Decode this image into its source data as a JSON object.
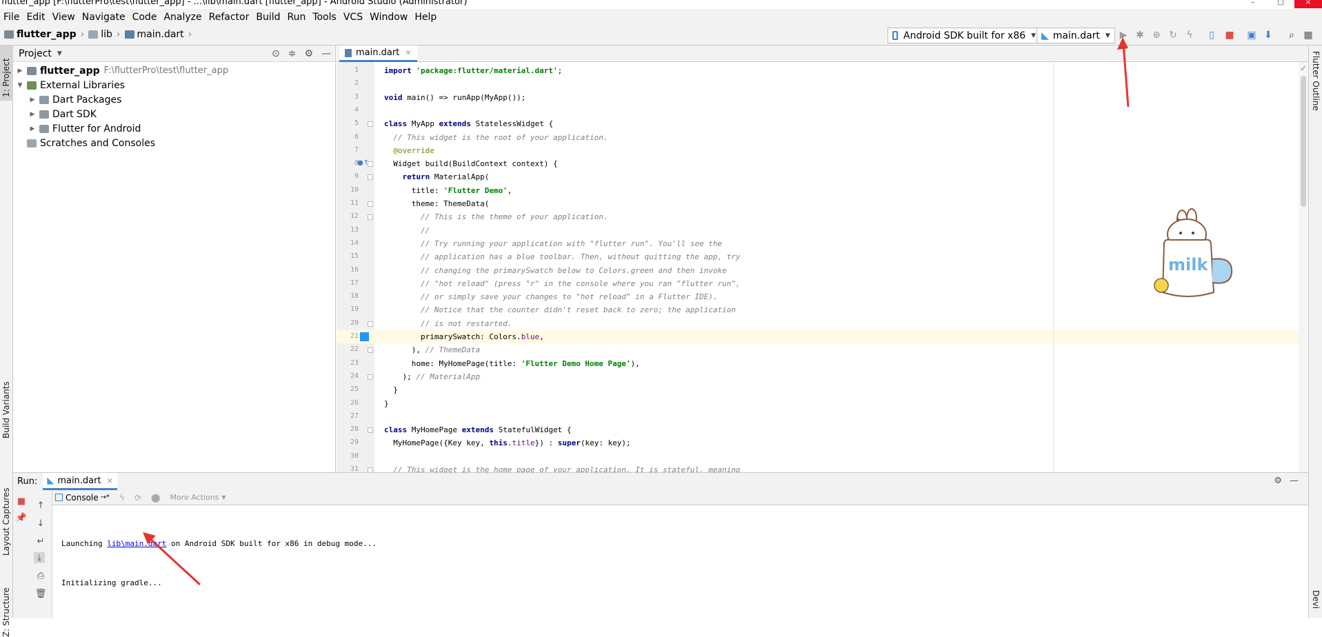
{
  "window": {
    "title": "flutter_app [F:\\flutterPro\\test\\flutter_app] - ...\\lib\\main.dart [flutter_app] - Android Studio (Administrator)"
  },
  "menu": [
    "File",
    "Edit",
    "View",
    "Navigate",
    "Code",
    "Analyze",
    "Refactor",
    "Build",
    "Run",
    "Tools",
    "VCS",
    "Window",
    "Help"
  ],
  "breadcrumb": {
    "project": "flutter_app",
    "folder": "lib",
    "file": "main.dart"
  },
  "toolbar": {
    "device": "Android SDK built for x86",
    "run_config": "main.dart"
  },
  "left_strip": {
    "project": "1: Project",
    "build_variants": "Build Variants",
    "layout_captures": "Layout Captures",
    "structure": "Z: Structure"
  },
  "right_strip": {
    "flutter_outline": "Flutter Outline",
    "device": "Devi"
  },
  "project_panel": {
    "header": "Project",
    "items": [
      {
        "label": "flutter_app",
        "path": "F:\\flutterPro\\test\\flutter_app",
        "level": 0,
        "expanded": false,
        "bold": true
      },
      {
        "label": "External Libraries",
        "level": 0,
        "expanded": true
      },
      {
        "label": "Dart Packages",
        "level": 1,
        "expanded": false
      },
      {
        "label": "Dart SDK",
        "level": 1,
        "expanded": false
      },
      {
        "label": "Flutter for Android",
        "level": 1,
        "expanded": false
      },
      {
        "label": "Scratches and Consoles",
        "level": 0,
        "expanded": null
      }
    ]
  },
  "editor": {
    "tab": "main.dart",
    "current_line": 21,
    "lines": [
      {
        "n": 1,
        "parts": [
          [
            "kw",
            "import "
          ],
          [
            "str",
            "'package:flutter/material.dart'"
          ],
          [
            "",
            "; "
          ]
        ]
      },
      {
        "n": 2,
        "parts": []
      },
      {
        "n": 3,
        "parts": [
          [
            "kw",
            "void "
          ],
          [
            "",
            "main() => runApp(MyApp());"
          ]
        ]
      },
      {
        "n": 4,
        "parts": []
      },
      {
        "n": 5,
        "parts": [
          [
            "kw",
            "class "
          ],
          [
            "",
            "MyApp "
          ],
          [
            "kw",
            "extends "
          ],
          [
            "",
            "StatelessWidget {"
          ]
        ]
      },
      {
        "n": 6,
        "parts": [
          [
            "cm",
            "  // This widget is the root of your application."
          ]
        ]
      },
      {
        "n": 7,
        "parts": [
          [
            "an",
            "  @override"
          ]
        ]
      },
      {
        "n": 8,
        "parts": [
          [
            "",
            "  Widget build(BuildContext context) {"
          ]
        ]
      },
      {
        "n": 9,
        "parts": [
          [
            "kw",
            "    return "
          ],
          [
            "",
            "MaterialApp("
          ]
        ]
      },
      {
        "n": 10,
        "parts": [
          [
            "",
            "      title: "
          ],
          [
            "str",
            "'Flutter Demo'"
          ],
          [
            "",
            ","
          ]
        ]
      },
      {
        "n": 11,
        "parts": [
          [
            "",
            "      theme: ThemeData("
          ]
        ]
      },
      {
        "n": 12,
        "parts": [
          [
            "cm",
            "        // This is the theme of your application."
          ]
        ]
      },
      {
        "n": 13,
        "parts": [
          [
            "cm",
            "        //"
          ]
        ]
      },
      {
        "n": 14,
        "parts": [
          [
            "cm",
            "        // Try running your application with \"flutter run\". You'll see the"
          ]
        ]
      },
      {
        "n": 15,
        "parts": [
          [
            "cm",
            "        // application has a blue toolbar. Then, without quitting the app, try"
          ]
        ]
      },
      {
        "n": 16,
        "parts": [
          [
            "cm",
            "        // changing the primarySwatch below to Colors.green and then invoke"
          ]
        ]
      },
      {
        "n": 17,
        "parts": [
          [
            "cm",
            "        // \"hot reload\" (press \"r\" in the console where you ran \"flutter run\","
          ]
        ]
      },
      {
        "n": 18,
        "parts": [
          [
            "cm",
            "        // or simply save your changes to \"hot reload\" in a Flutter IDE)."
          ]
        ]
      },
      {
        "n": 19,
        "parts": [
          [
            "cm",
            "        // Notice that the counter didn't reset back to zero; the application"
          ]
        ]
      },
      {
        "n": 20,
        "parts": [
          [
            "cm",
            "        // is not restarted."
          ]
        ]
      },
      {
        "n": 21,
        "parts": [
          [
            "",
            "        primarySwatch: Colors."
          ],
          [
            "fld",
            "blue"
          ],
          [
            "",
            ","
          ]
        ]
      },
      {
        "n": 22,
        "parts": [
          [
            "",
            "      ), "
          ],
          [
            "cm",
            "// ThemeData"
          ]
        ]
      },
      {
        "n": 23,
        "parts": [
          [
            "",
            "      home: MyHomePage(title: "
          ],
          [
            "str",
            "'Flutter Demo Home Page'"
          ],
          [
            "",
            "),"
          ]
        ]
      },
      {
        "n": 24,
        "parts": [
          [
            "",
            "    ); "
          ],
          [
            "cm",
            "// MaterialApp"
          ]
        ]
      },
      {
        "n": 25,
        "parts": [
          [
            "",
            "  }"
          ]
        ]
      },
      {
        "n": 26,
        "parts": [
          [
            "",
            "}"
          ]
        ]
      },
      {
        "n": 27,
        "parts": []
      },
      {
        "n": 28,
        "parts": [
          [
            "kw",
            "class "
          ],
          [
            "",
            "MyHomePage "
          ],
          [
            "kw",
            "extends "
          ],
          [
            "",
            "StatefulWidget {"
          ]
        ]
      },
      {
        "n": 29,
        "parts": [
          [
            "",
            "  MyHomePage({Key key, "
          ],
          [
            "kw",
            "this"
          ],
          [
            "",
            "."
          ],
          [
            "fld",
            "title"
          ],
          [
            "",
            "}) : "
          ],
          [
            "kw",
            "super"
          ],
          [
            "",
            "(key: key);"
          ]
        ]
      },
      {
        "n": 30,
        "parts": []
      },
      {
        "n": 31,
        "parts": [
          [
            "cm",
            "  // This widget is the home page of your application. It is stateful, meaning"
          ]
        ]
      }
    ]
  },
  "sticker": {
    "text": "milk",
    "accent": "#6fb3e6"
  },
  "run_panel": {
    "label": "Run:",
    "tab": "main.dart",
    "console_tab": "Console",
    "more_actions": "More Actions",
    "console": {
      "line1_prefix": "Launching ",
      "line1_link": "lib\\main.dart",
      "line1_suffix": " on Android SDK built for x86 in debug mode...",
      "line2": "Initializing gradle..."
    }
  },
  "colors": {
    "accent": "#4083c9",
    "arrow": "#e8332f",
    "stop": "#d9534f",
    "current_line": "#fffae3"
  }
}
